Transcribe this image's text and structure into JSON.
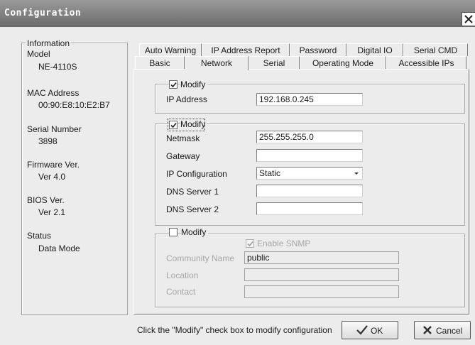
{
  "window": {
    "title": "Configuration"
  },
  "info": {
    "group_label": "Information",
    "items": [
      {
        "label": "Model",
        "value": "NE-4110S"
      },
      {
        "label": "MAC Address",
        "value": "00:90:E8:10:E2:B7"
      },
      {
        "label": "Serial Number",
        "value": "3898"
      },
      {
        "label": "Firmware Ver.",
        "value": "Ver 4.0"
      },
      {
        "label": "BIOS Ver.",
        "value": "Ver 2.1"
      },
      {
        "label": "Status",
        "value": "Data Mode"
      }
    ]
  },
  "tabs": {
    "back_row": [
      "Auto Warning",
      "IP Address Report",
      "Password",
      "Digital IO",
      "Serial CMD"
    ],
    "front_row": [
      "Basic",
      "Network",
      "Serial",
      "Operating Mode",
      "Accessible IPs"
    ],
    "active": "Network"
  },
  "group1": {
    "modify_label": "Modify",
    "modify_checked": true,
    "ip_label": "IP Address",
    "ip_value": "192.168.0.245"
  },
  "group2": {
    "modify_label": "Modify",
    "modify_checked": true,
    "netmask_label": "Netmask",
    "netmask_value": "255.255.255.0",
    "gateway_label": "Gateway",
    "gateway_value": "",
    "ipconfig_label": "IP Configuration",
    "ipconfig_value": "Static",
    "dns1_label": "DNS Server 1",
    "dns1_value": "",
    "dns2_label": "DNS Server 2",
    "dns2_value": ""
  },
  "group3": {
    "modify_label": "Modify",
    "modify_checked": false,
    "snmp_label": "Enable SNMP",
    "snmp_checked": true,
    "community_label": "Community Name",
    "community_value": "public",
    "location_label": "Location",
    "location_value": "",
    "contact_label": "Contact",
    "contact_value": ""
  },
  "footer": {
    "hint": "Click the \"Modify\" check box to modify configuration",
    "ok_label": "OK",
    "cancel_label": "Cancel"
  },
  "icons": {
    "close": "close-icon",
    "ok": "checkmark-icon",
    "cancel": "x-icon",
    "dropdown": "chevron-down-icon"
  }
}
